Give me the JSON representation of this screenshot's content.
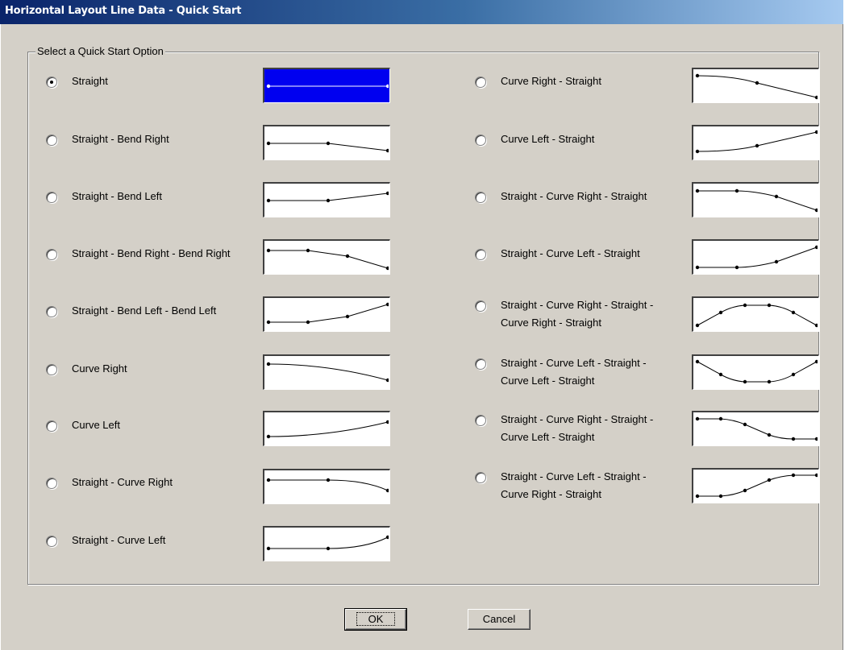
{
  "window": {
    "title": "Horizontal Layout Line Data - Quick Start"
  },
  "group": {
    "legend": "Select a Quick Start Option"
  },
  "options": [
    {
      "label": "Straight",
      "selected": true
    },
    {
      "label": "Straight - Bend Right"
    },
    {
      "label": "Straight - Bend Left"
    },
    {
      "label": "Straight - Bend Right - Bend Right"
    },
    {
      "label": "Straight - Bend Left - Bend Left"
    },
    {
      "label": "Curve Right"
    },
    {
      "label": "Curve Left"
    },
    {
      "label": "Straight - Curve Right"
    },
    {
      "label": "Straight - Curve Left"
    },
    {
      "label": "Curve Right - Straight"
    },
    {
      "label": "Curve Left - Straight"
    },
    {
      "label": "Straight - Curve Right - Straight"
    },
    {
      "label": "Straight - Curve Left - Straight"
    },
    {
      "label": "Straight - Curve Right - Straight -\nCurve Right - Straight"
    },
    {
      "label": "Straight - Curve Left - Straight -\nCurve Left - Straight"
    },
    {
      "label": "Straight - Curve Right - Straight -\nCurve Left - Straight"
    },
    {
      "label": "Straight - Curve Left - Straight -\nCurve Right - Straight"
    }
  ],
  "buttons": {
    "ok": "OK",
    "cancel": "Cancel"
  },
  "colors": {
    "selected_preview": "#0000f0",
    "title_bar": "#0a246a"
  }
}
